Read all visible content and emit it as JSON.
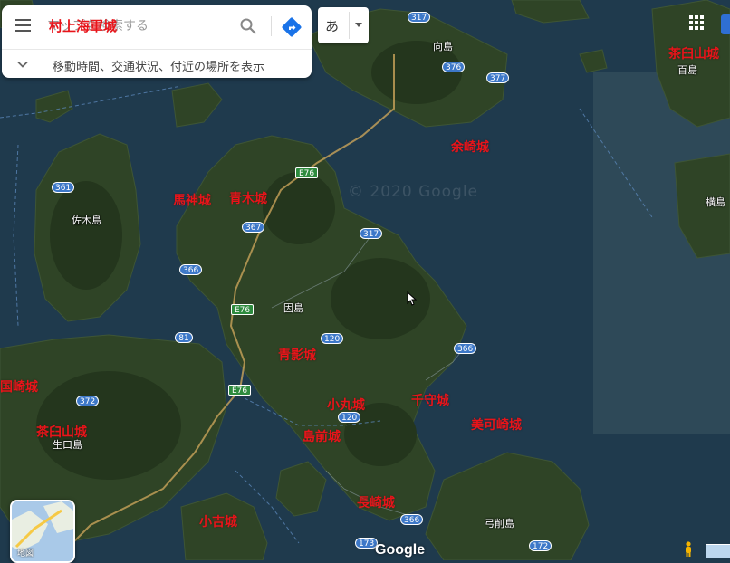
{
  "search": {
    "placeholder": "マップを検索する",
    "query": "村上海軍城",
    "sub_text": "移動時間、交通状況、付近の場所を表示"
  },
  "ime": {
    "char": "あ"
  },
  "map": {
    "watermark": "© 2020 Google",
    "castles": [
      {
        "label": "余崎城"
      },
      {
        "label": "馬神城"
      },
      {
        "label": "青木城"
      },
      {
        "label": "青影城"
      },
      {
        "label": "小丸城"
      },
      {
        "label": "千守城"
      },
      {
        "label": "美可崎城"
      },
      {
        "label": "島前城"
      },
      {
        "label": "長崎城"
      },
      {
        "label": "小吉城"
      },
      {
        "label": "茶臼山城"
      },
      {
        "label": "国崎城"
      },
      {
        "label": "茶臼山城"
      }
    ],
    "places": [
      {
        "label": "向島"
      },
      {
        "label": "佐木島"
      },
      {
        "label": "因島"
      },
      {
        "label": "生口島"
      },
      {
        "label": "弓削島"
      },
      {
        "label": "百島"
      },
      {
        "label": "横島"
      }
    ],
    "routes": [
      {
        "label": "317"
      },
      {
        "label": "376"
      },
      {
        "label": "377"
      },
      {
        "label": "361"
      },
      {
        "label": "367"
      },
      {
        "label": "317"
      },
      {
        "label": "366"
      },
      {
        "label": "81"
      },
      {
        "label": "120"
      },
      {
        "label": "366"
      },
      {
        "label": "372"
      },
      {
        "label": "120"
      },
      {
        "label": "366"
      },
      {
        "label": "173"
      },
      {
        "label": "172"
      }
    ],
    "expressways": [
      {
        "label": "E76"
      },
      {
        "label": "E76"
      },
      {
        "label": "E76"
      }
    ]
  },
  "layer_toggle": {
    "label": "地図"
  },
  "footer": {
    "logo": "Google"
  },
  "colors": {
    "castle_label": "#e8141a",
    "route_shield": "#3d78c8",
    "expressway": "#2e8b3e",
    "sea": "#1f3a4d"
  }
}
